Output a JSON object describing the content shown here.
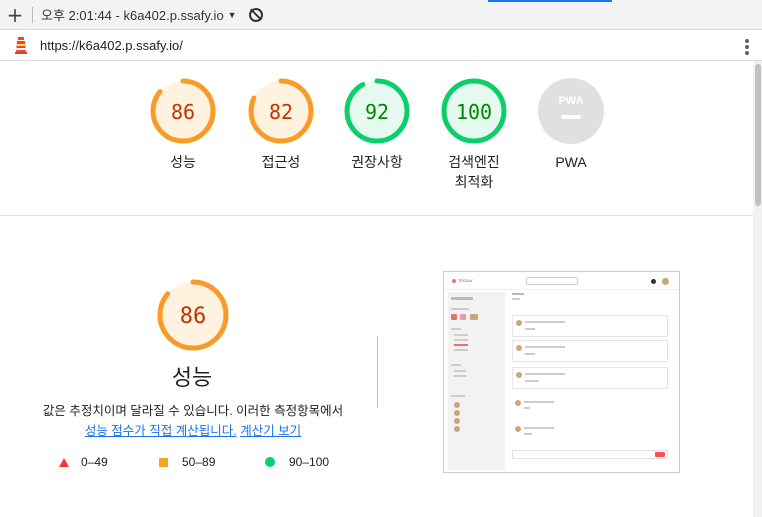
{
  "browser": {
    "tab_title": "오후 2:01:44 - k6a402.p.ssafy.io",
    "url": "https://k6a402.p.ssafy.io/"
  },
  "gauges": [
    {
      "score": "86",
      "label": "성능",
      "fraction": 0.86,
      "status": "average"
    },
    {
      "score": "82",
      "label": "접근성",
      "fraction": 0.82,
      "status": "average"
    },
    {
      "score": "92",
      "label": "권장사항",
      "fraction": 0.92,
      "status": "pass"
    },
    {
      "score": "100",
      "label_line1": "검색엔진",
      "label_line2": "최적화",
      "fraction": 1.0,
      "status": "pass"
    },
    {
      "score": "PWA",
      "label": "PWA",
      "status": "na"
    }
  ],
  "performance": {
    "score": "86",
    "fraction": 0.86,
    "title": "성능",
    "desc_line1": "값은 추정치이며 달라질 수 있습니다. 이러한 측정항목에서",
    "desc_link1": "성능 점수가 직접 계산됩니다.",
    "desc_link2": "계산기 보기"
  },
  "legend": {
    "fail": "0–49",
    "average": "50–89",
    "pass": "90–100"
  },
  "thumbnail": {
    "app_name": "TOOLIV"
  },
  "colors": {
    "average": "#fa9b29",
    "average_bg": "#fff3e0",
    "average_text": "#c33300",
    "pass": "#0cce6b",
    "pass_bg": "#e6f9ef",
    "pass_text": "#008800",
    "fail": "#ff3333",
    "na": "#e0e0e0"
  }
}
